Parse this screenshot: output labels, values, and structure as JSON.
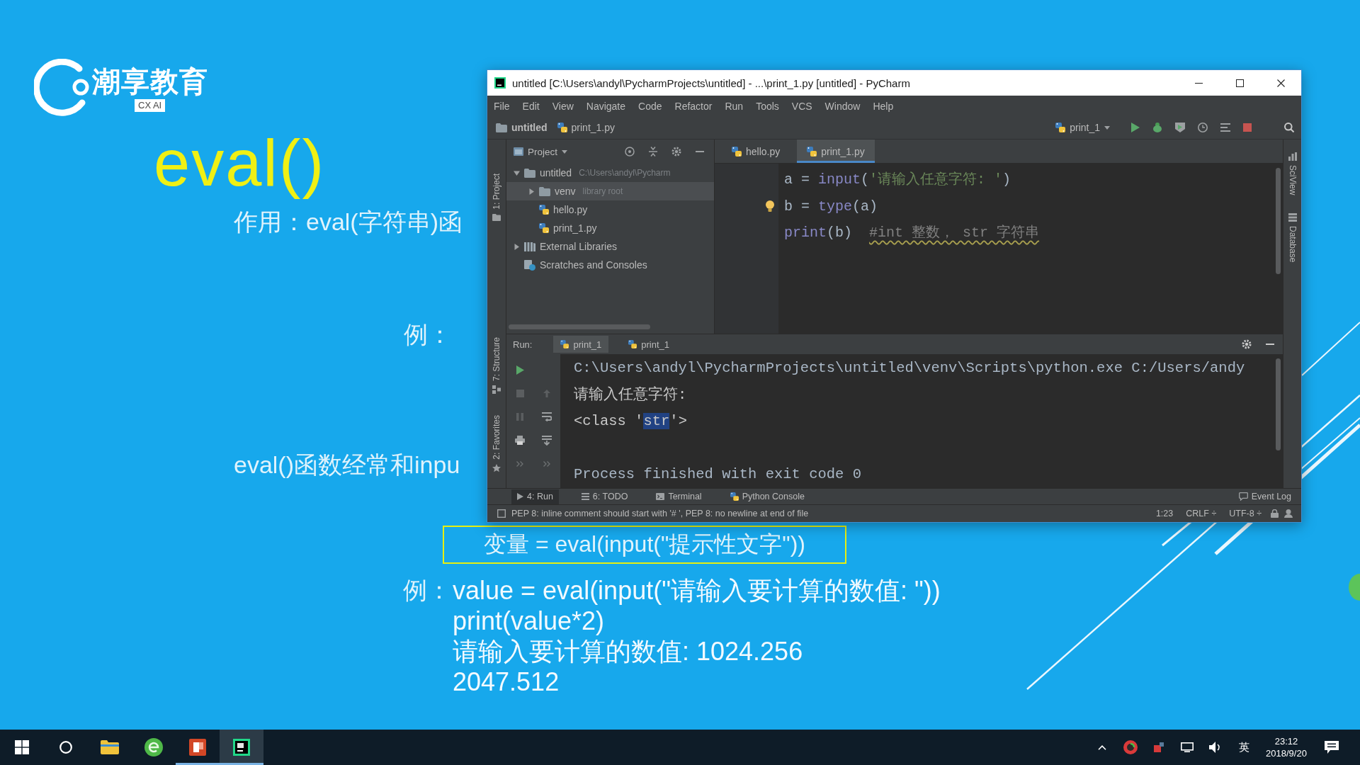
{
  "slide": {
    "logo": {
      "name": "潮享教育",
      "badge": "CX AI"
    },
    "title": "eval()",
    "purpose": "作用：eval(字符串)函",
    "example_label": "例：",
    "usage_note": "eval()函数经常和inpu",
    "syntax": "变量 = eval(input(\"提示性文字\"))",
    "example": {
      "label": "例：",
      "lines": [
        "value = eval(input(\"请输入要计算的数值: \"))",
        "print(value*2)",
        "请输入要计算的数值: 1024.256",
        "2047.512"
      ]
    }
  },
  "window": {
    "title": "untitled [C:\\Users\\andyl\\PycharmProjects\\untitled] - ...\\print_1.py [untitled] - PyCharm",
    "menu": [
      "File",
      "Edit",
      "View",
      "Navigate",
      "Code",
      "Refactor",
      "Run",
      "Tools",
      "VCS",
      "Window",
      "Help"
    ],
    "breadcrumbs": [
      {
        "label": "untitled",
        "kind": "folder"
      },
      {
        "label": "print_1.py",
        "kind": "python"
      }
    ],
    "run_config": "print_1",
    "left_tool_windows": [
      {
        "label": "1: Project",
        "kind": "project"
      },
      {
        "label": "7: Structure",
        "kind": "structure"
      },
      {
        "label": "2: Favorites",
        "kind": "favorites"
      }
    ],
    "right_tool_windows": [
      {
        "label": "SciView",
        "kind": "sciview"
      },
      {
        "label": "Database",
        "kind": "database"
      }
    ],
    "project_panel": {
      "title": "Project",
      "tree": [
        {
          "label": "untitled",
          "detail": "C:\\Users\\andyl\\Pycharm",
          "kind": "folder",
          "expanded": true,
          "selected": false,
          "children": [
            {
              "label": "venv",
              "detail": "library root",
              "kind": "folder",
              "expanded": false,
              "selected": true
            },
            {
              "label": "hello.py",
              "kind": "python",
              "selected": false
            },
            {
              "label": "print_1.py",
              "kind": "python",
              "selected": false
            }
          ]
        },
        {
          "label": "External Libraries",
          "kind": "library",
          "expanded": false,
          "selected": false
        },
        {
          "label": "Scratches and Consoles",
          "kind": "scratches",
          "selected": false
        }
      ]
    },
    "editor": {
      "tabs": [
        {
          "label": "hello.py",
          "selected": false
        },
        {
          "label": "print_1.py",
          "selected": true
        }
      ],
      "lines": [
        {
          "bulb": false,
          "warning": false,
          "tokens": [
            {
              "text": "a = ",
              "kind": "plain"
            },
            {
              "text": "input",
              "kind": "builtin"
            },
            {
              "text": "(",
              "kind": "plain"
            },
            {
              "text": "'请输入任意字符: '",
              "kind": "string"
            },
            {
              "text": ")",
              "kind": "plain"
            }
          ]
        },
        {
          "bulb": true,
          "warning": false,
          "tokens": [
            {
              "text": "b = ",
              "kind": "plain"
            },
            {
              "text": "type",
              "kind": "builtin"
            },
            {
              "text": "(a)",
              "kind": "plain"
            }
          ]
        },
        {
          "bulb": false,
          "warning": true,
          "tokens": [
            {
              "text": "print",
              "kind": "builtin"
            },
            {
              "text": "(b)  ",
              "kind": "plain"
            },
            {
              "text": "#int 整数， str 字符串",
              "kind": "comment"
            }
          ]
        }
      ]
    },
    "run_panel": {
      "label": "Run:",
      "tabs": [
        {
          "label": "print_1",
          "selected": true
        },
        {
          "label": "print_1",
          "selected": false
        }
      ],
      "console": [
        {
          "kind": "command",
          "segments": [
            {
              "text": "C:\\Users\\andyl\\PycharmProjects\\untitled\\venv\\Scripts\\python.exe C:/Users/andy",
              "selected": false
            }
          ]
        },
        {
          "kind": "output",
          "segments": [
            {
              "text": "请输入任意字符:",
              "selected": false
            }
          ]
        },
        {
          "kind": "output",
          "segments": [
            {
              "text": "<class '",
              "selected": false
            },
            {
              "text": "str",
              "selected": true
            },
            {
              "text": "'>",
              "selected": false
            }
          ]
        },
        {
          "kind": "exit",
          "segments": [
            {
              "text": "Process finished with exit code 0",
              "selected": false
            }
          ]
        }
      ]
    },
    "tool_tabs": [
      {
        "label": "4: Run",
        "kind": "run",
        "selected": true
      },
      {
        "label": "6: TODO",
        "kind": "todo",
        "selected": false
      },
      {
        "label": "Terminal",
        "kind": "terminal",
        "selected": false
      },
      {
        "label": "Python Console",
        "kind": "console",
        "selected": false
      }
    ],
    "event_log": "Event Log",
    "status_bar": {
      "message": "PEP 8: inline comment should start with '# ', PEP 8: no newline at end of file",
      "position": "1:23",
      "line_separator": "CRLF ÷",
      "encoding": "UTF-8 ÷"
    }
  },
  "taskbar": {
    "apps": [
      {
        "kind": "explorer",
        "running": false,
        "selected": false
      },
      {
        "kind": "browser",
        "running": false,
        "selected": false
      },
      {
        "kind": "slides",
        "running": true,
        "selected": false
      },
      {
        "kind": "ide",
        "running": true,
        "selected": true
      }
    ],
    "ime": "英",
    "time": "23:12",
    "date": "2018/9/20"
  }
}
